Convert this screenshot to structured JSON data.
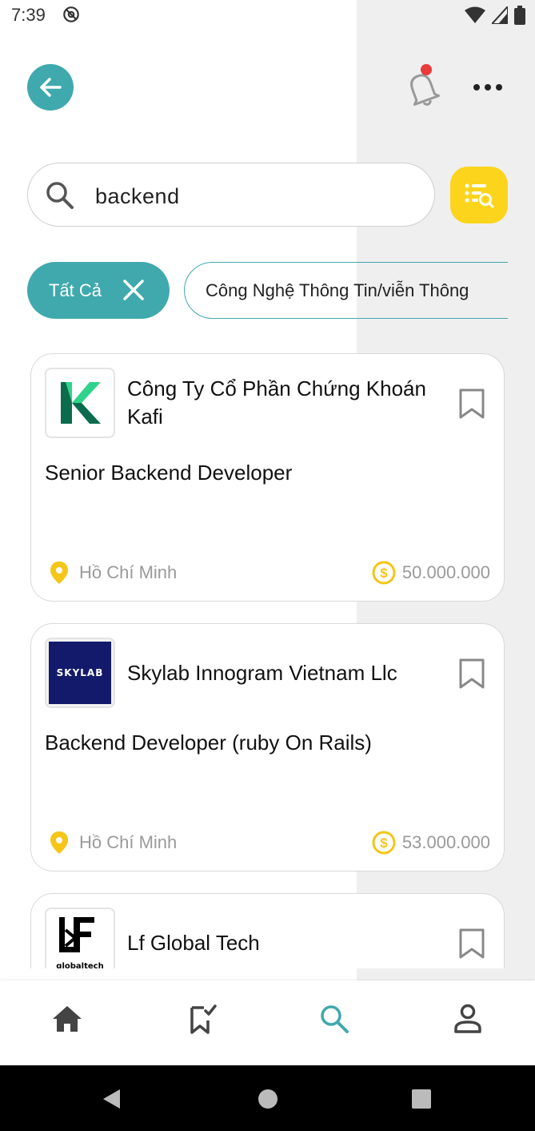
{
  "status_bar": {
    "time": "7:39"
  },
  "header": {
    "back_icon": "arrow-left-icon",
    "notification_icon": "bell-icon",
    "more_icon": "more-horizontal-icon"
  },
  "search": {
    "value": "backend",
    "placeholder": ""
  },
  "filters": {
    "all_label": "Tất Cả",
    "category_label": "Công Nghệ Thông Tin/viễn Thông"
  },
  "jobs": [
    {
      "company": "Công Ty Cổ Phần Chứng Khoán Kafi",
      "title": "Senior Backend Developer",
      "location": "Hồ Chí Minh",
      "salary": "50.000.000"
    },
    {
      "company": "Skylab Innogram Vietnam Llc",
      "title": "Backend Developer (ruby On Rails)",
      "location": "Hồ Chí Minh",
      "salary": "53.000.000",
      "logo_text": "SKYLAB"
    },
    {
      "company": "Lf Global Tech",
      "logo_text": "globaltech"
    }
  ],
  "bottom_nav": [
    "home-icon",
    "saved-jobs-icon",
    "search-icon",
    "profile-icon"
  ],
  "colors": {
    "accent": "#3fa9ad",
    "yellow": "#fcd41c",
    "notification": "#ea3a3a"
  }
}
